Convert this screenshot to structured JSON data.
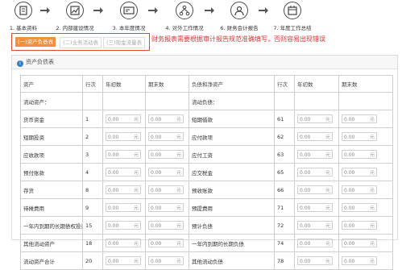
{
  "steps": [
    {
      "label": "1. 基本资料"
    },
    {
      "label": "2. 内部建设情况"
    },
    {
      "label": "3. 本年度情况"
    },
    {
      "label": "4. 对外工作情况"
    },
    {
      "label": "6. 财务会计报告"
    },
    {
      "label": "7. 年度工作总结"
    }
  ],
  "tabs": [
    "(一)资产负债表",
    "(二)业务活动表",
    "(三)现金流量表"
  ],
  "warning": "财务报表需要根据审计报告规范准确填写，否则容易出现错误",
  "panel_title": "资产负债表",
  "columns": [
    "资产",
    "行次",
    "年初数",
    "期末数",
    "负债和净资产",
    "行次",
    "年初数",
    "期末数"
  ],
  "input_value": "0.00",
  "input_unit": "元",
  "rows": [
    {
      "left": "流动资产：",
      "lno": "",
      "right": "流动负债：",
      "rno": "",
      "inputs": false
    },
    {
      "left": "货币资金",
      "lno": "1",
      "right": "短期借款",
      "rno": "61",
      "inputs": true
    },
    {
      "left": "短期投资",
      "lno": "2",
      "right": "应付款项",
      "rno": "62",
      "inputs": true
    },
    {
      "left": "应收款项",
      "lno": "3",
      "right": "应付工资",
      "rno": "63",
      "inputs": true
    },
    {
      "left": "预付账款",
      "lno": "4",
      "right": "应交税金",
      "rno": "65",
      "inputs": true
    },
    {
      "left": "存货",
      "lno": "8",
      "right": "预收账款",
      "rno": "66",
      "inputs": true
    },
    {
      "left": "待摊费用",
      "lno": "9",
      "right": "预提费用",
      "rno": "71",
      "inputs": true
    },
    {
      "left": "一年内到期的长期债权投资",
      "lno": "15",
      "right": "预计负债",
      "rno": "72",
      "inputs": true
    },
    {
      "left": "其他流动资产",
      "lno": "18",
      "right": "一年内到期的长期负债",
      "rno": "74",
      "inputs": true
    },
    {
      "left": "流动资产合计",
      "lno": "20",
      "right": "其他流动负债",
      "rno": "78",
      "inputs": true
    }
  ]
}
